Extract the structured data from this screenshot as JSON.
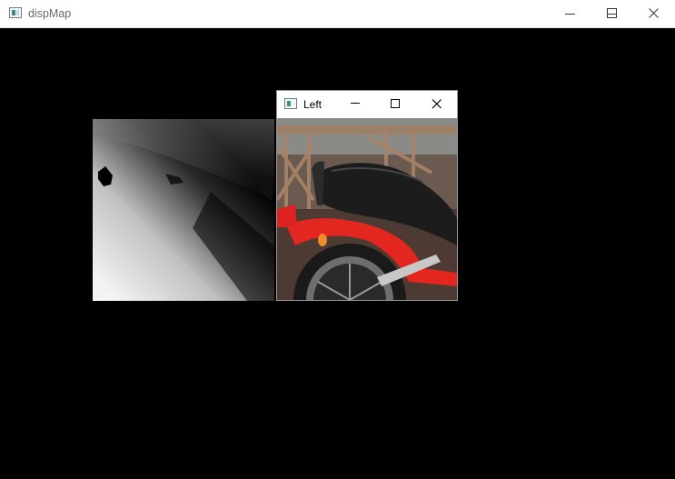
{
  "main_window": {
    "title": "dispMap",
    "icon": "opencv-window-icon",
    "controls": [
      "minimize-icon",
      "maximize-icon",
      "close-icon"
    ]
  },
  "disparity_map": {
    "description_colors": {
      "dark": "#000000",
      "light": "#ffffff"
    }
  },
  "child_window": {
    "title": "Left",
    "icon": "opencv-window-icon",
    "controls": [
      "minimize-icon",
      "maximize-icon",
      "close-icon"
    ]
  },
  "colors": {
    "background": "#000000",
    "titlebar": "#ffffff",
    "motorcycle_red": "#e3261f"
  }
}
